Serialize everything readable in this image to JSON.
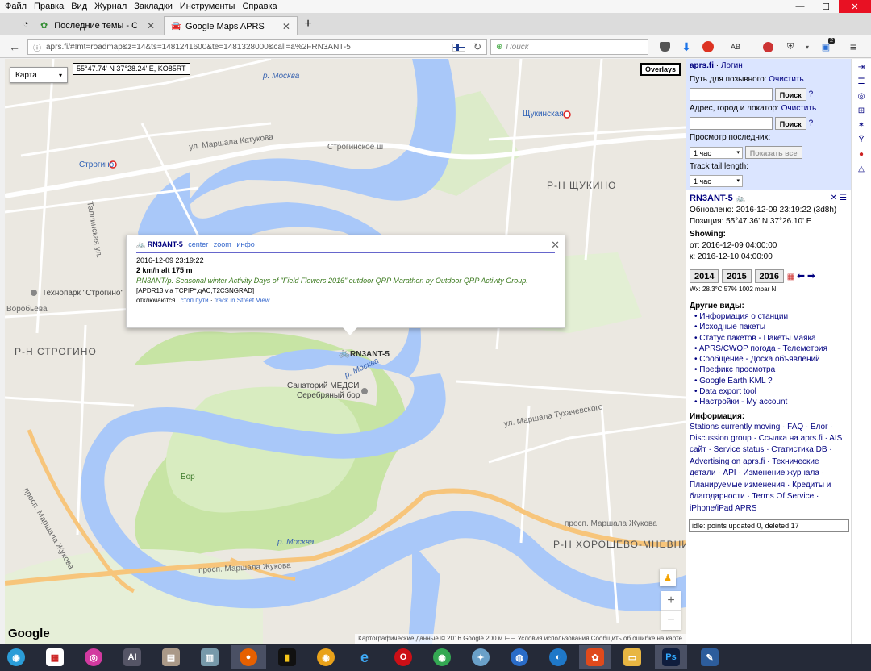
{
  "menu": [
    "Файл",
    "Правка",
    "Вид",
    "Журнал",
    "Закладки",
    "Инструменты",
    "Справка"
  ],
  "window_controls": {
    "minimize": "—",
    "maximize": "☐",
    "close": "✕"
  },
  "tabs": [
    {
      "label": "Последние темы - Outdo…"
    },
    {
      "label": "Google Maps APRS"
    }
  ],
  "new_tab": "+",
  "nav": {
    "url": "aprs.fi/#!mt=roadmap&z=14&ts=1481241600&te=1481328000&call=a%2FRN3ANT-5",
    "search_placeholder": "Поиск",
    "ab_label": "AB",
    "notif_count": "2"
  },
  "map": {
    "type_label": "Карта",
    "coords": "55°47.74' N 37°28.24' E, KO85RT",
    "overlays_label": "Overlays",
    "labels": {
      "moskva_top": "р. Москва",
      "schukinskaya": "Щукинская",
      "strogino": "Строгино",
      "stroginskoe": "Строгинское ш",
      "katukova": "ул. Маршала Катукова",
      "tallinskaya": "Таллинская ул.",
      "schukino": "Р-Н ЩУКИНО",
      "technopark": "Технопарк \"Строгино\"",
      "vorobyova": "Воробьёва",
      "strogino_district": "Р-Н СТРОГИНО",
      "sanatoriy": "Санаторий МЕДСИ",
      "serebryany_bor_park": "Серебряный бор",
      "serebryany_bor": "Серебряный",
      "bor": "Бор",
      "moskva_mid": "р. Москва",
      "moskva_bottom": "р. Москва",
      "zhukova_1": "просп. Маршала Жукова",
      "zhukova_2": "просп. Маршала Жукова",
      "zhukova_3": "просп. Маршала Жукова",
      "tukhachevskogo": "ул. Маршала Тухачевского",
      "khoroshevo": "Р-Н ХОРОШЕВО-МНЕВНИКИ"
    },
    "popup": {
      "callsign": "RN3ANT-5",
      "link_center": "center",
      "link_zoom": "zoom",
      "link_info": "инфо",
      "time": "2016-12-09 23:19:22",
      "speed_alt": "2 km/h alt 175 m",
      "comment": "RN3ANT/p. Seasonal winter Activity Days of \"Field Flowers 2016\" outdoor QRP Marathon by Outdoor QRP Activity Group.",
      "path": "[APDR13 via TCPIP*,qAC,T2CSNGRAD]",
      "footer_prefix": "отключаются",
      "link_track": "стоп пути",
      "link_streetview": "track in Street View",
      "close": "✕"
    },
    "marker_label": "RN3ANT-5",
    "zoom_in": "+",
    "zoom_out": "−",
    "google": "Google",
    "attribution": "Картографические данные © 2016 Google   200 м ⊢⊣   Условия использования   Сообщить об ошибке на карте"
  },
  "panel": {
    "site": "aprs.fi",
    "login": "Логин",
    "path_label": "Путь для позывного:",
    "clear1": "Очистить",
    "search_btn1": "Поиск",
    "q1": "?",
    "addr_label": "Адрес, город и локатор:",
    "clear2": "Очистить",
    "search_btn2": "Поиск",
    "q2": "?",
    "view_last_label": "Просмотр последних:",
    "view_last_value": "1 час",
    "show_all": "Показать все",
    "tail_label": "Track tail length:",
    "tail_value": "1 час",
    "station": {
      "callsign": "RN3ANT-5",
      "updated": "Обновлено: 2016-12-09 23:19:22 (3d8h)",
      "position": "Позиция: 55°47.36' N 37°26.10' E",
      "showing": "Showing:",
      "from": "от: 2016-12-09 04:00:00",
      "to": "к: 2016-12-10 04:00:00",
      "years": [
        "2014",
        "2015",
        "2016"
      ],
      "weather": "Wx: 28.3°C 57% 1002 mbar N"
    },
    "other_views_title": "Другие виды:",
    "other_views": [
      "Информация о станции",
      "Исходные пакеты",
      "Статус пакетов - Пакеты маяка",
      "APRS/CWOP погода - Телеметрия",
      "Сообщение - Доска объявлений",
      "Префикс просмотра",
      "Google Earth KML ?",
      "Data export tool",
      "Настройки - My account"
    ],
    "info_title": "Информация:",
    "info_text": "Stations currently moving · FAQ · Блог · Discussion group · Ссылка на aprs.fi · AIS сайт · Service status · Статистика DB · Advertising on aprs.fi · Технические детали · API · Изменение журнала · Планируемые изменения · Кредиты и благодарности · Terms Of Service · iPhone/iPad APRS",
    "status": "idle: points updated 0, deleted 17"
  },
  "colors": {
    "water": "#a9c8f9",
    "park": "#c7e4a4",
    "road_major": "#f7c57b",
    "panel_bg": "#dbe5ff",
    "link": "#00007f",
    "taskbar": "#252a38"
  }
}
